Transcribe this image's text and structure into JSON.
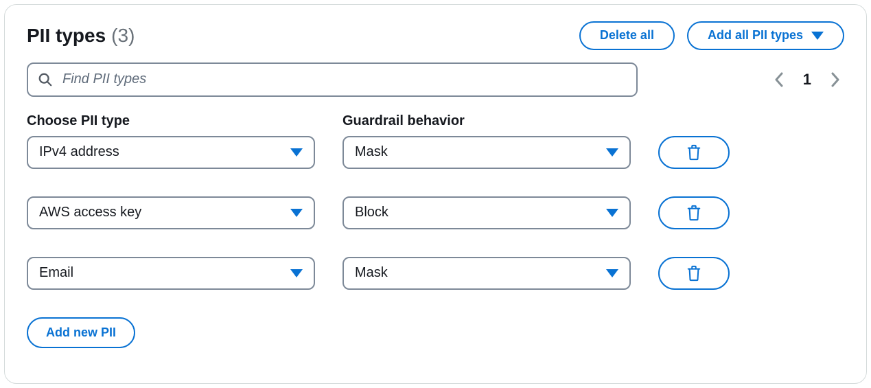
{
  "header": {
    "title": "PII types",
    "count_display": "(3)",
    "delete_all_label": "Delete all",
    "add_all_label": "Add all PII types"
  },
  "search": {
    "placeholder": "Find PII types"
  },
  "pagination": {
    "current_page": "1"
  },
  "columns": {
    "pii_type": "Choose PII type",
    "behavior": "Guardrail behavior"
  },
  "rows": [
    {
      "pii_type": "IPv4 address",
      "behavior": "Mask"
    },
    {
      "pii_type": "AWS access key",
      "behavior": "Block"
    },
    {
      "pii_type": "Email",
      "behavior": "Mask"
    }
  ],
  "footer": {
    "add_new_label": "Add new PII"
  },
  "icons": {
    "search": "search-icon",
    "caret_down": "caret-down-icon",
    "chevron_left": "chevron-left-icon",
    "chevron_right": "chevron-right-icon",
    "trash": "trash-icon"
  },
  "colors": {
    "primary": "#0972d3",
    "border": "#7d8998",
    "muted": "#687078"
  }
}
